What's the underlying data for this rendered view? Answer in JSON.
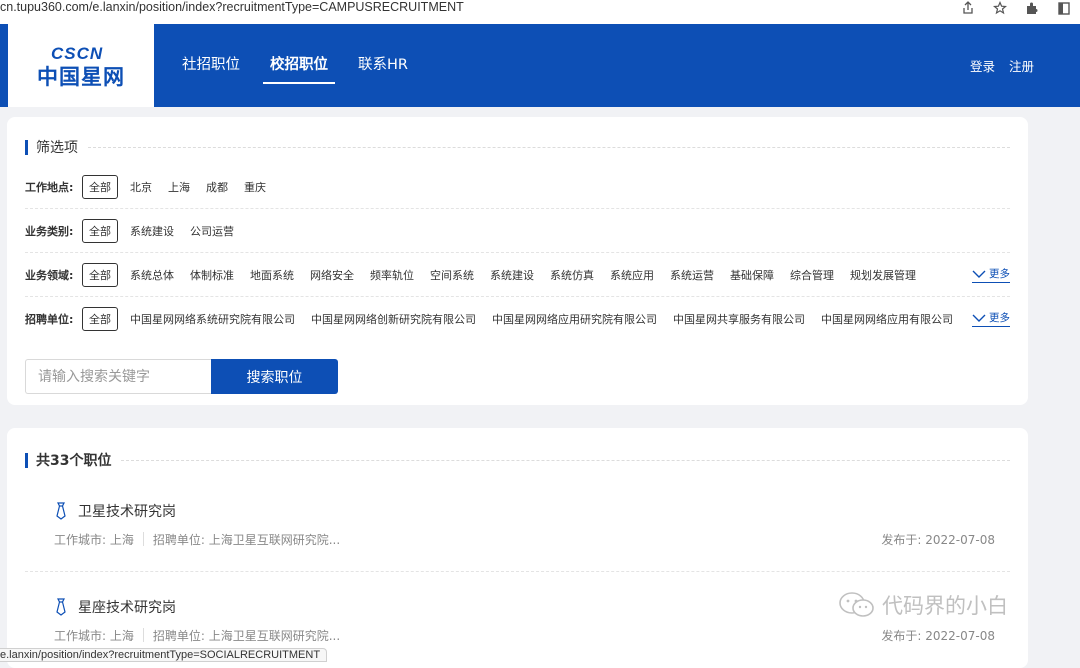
{
  "browser": {
    "url": "cn.tupu360.com/e.lanxin/position/index?recruitmentType=CAMPUSRECRUITMENT",
    "icons": [
      "share-icon",
      "star-icon",
      "extensions-icon",
      "sidebar-icon"
    ],
    "status_url": "e.lanxin/position/index?recruitmentType=SOCIALRECRUITMENT"
  },
  "header": {
    "logo_top": "CSCN",
    "logo_bottom": "中国星网",
    "nav": [
      {
        "label": "社招职位",
        "active": false
      },
      {
        "label": "校招职位",
        "active": true
      },
      {
        "label": "联系HR",
        "active": false
      }
    ],
    "login": "登录",
    "register": "注册",
    "bg_color": "#0d4fb5"
  },
  "filters": {
    "title": "筛选项",
    "more_label": "更多",
    "rows": [
      {
        "label": "工作地点:",
        "options": [
          "全部",
          "北京",
          "上海",
          "成都",
          "重庆"
        ],
        "selected": 0,
        "has_more": false
      },
      {
        "label": "业务类别:",
        "options": [
          "全部",
          "系统建设",
          "公司运营"
        ],
        "selected": 0,
        "has_more": false
      },
      {
        "label": "业务领域:",
        "options": [
          "全部",
          "系统总体",
          "体制标准",
          "地面系统",
          "网络安全",
          "频率轨位",
          "空间系统",
          "系统建设",
          "系统仿真",
          "系统应用",
          "系统运营",
          "基础保障",
          "综合管理",
          "规划发展管理"
        ],
        "selected": 0,
        "has_more": true
      },
      {
        "label": "招聘单位:",
        "options": [
          "全部",
          "中国星网网络系统研究院有限公司",
          "中国星网网络创新研究院有限公司",
          "中国星网网络应用研究院有限公司",
          "中国星网共享服务有限公司",
          "中国星网网络应用有限公司"
        ],
        "selected": 0,
        "has_more": true
      }
    ]
  },
  "search": {
    "placeholder": "请输入搜索关键字",
    "button": "搜索职位"
  },
  "list": {
    "title": "共33个职位",
    "jobs": [
      {
        "title": "卫星技术研究岗",
        "city": "工作城市: 上海",
        "unit": "招聘单位: 上海卫星互联网研究院...",
        "date": "发布于: 2022-07-08"
      },
      {
        "title": "星座技术研究岗",
        "city": "工作城市: 上海",
        "unit": "招聘单位: 上海卫星互联网研究院...",
        "date": "发布于: 2022-07-08"
      }
    ]
  },
  "watermark": {
    "text": "代码界的小白",
    "icon": "wechat-icon"
  }
}
